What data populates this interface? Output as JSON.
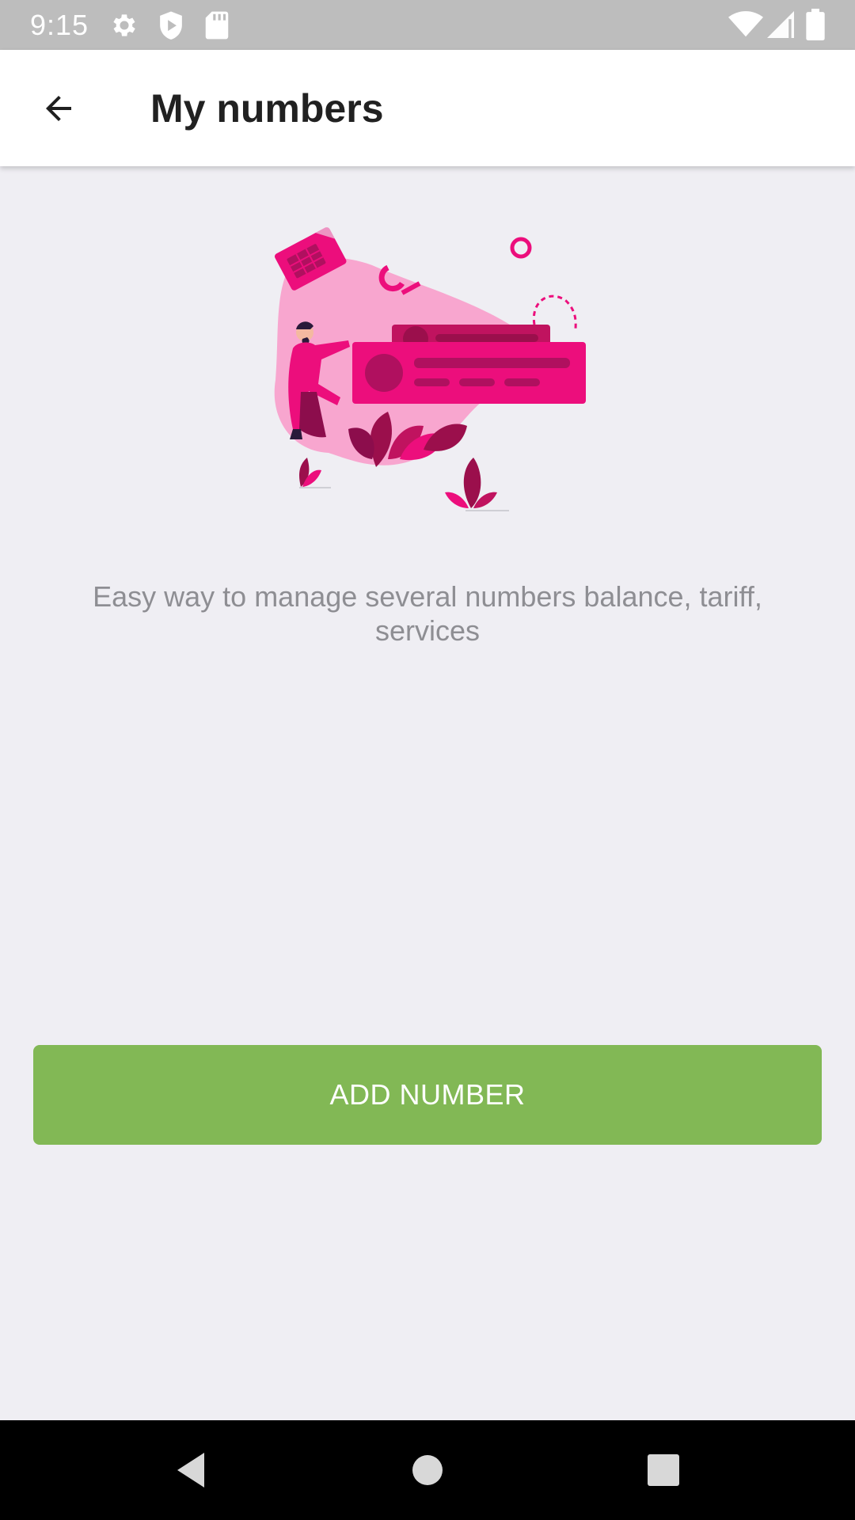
{
  "status_bar": {
    "time": "9:15",
    "left_icons": [
      "settings-icon",
      "shield-play-icon",
      "sd-card-icon"
    ],
    "right_icons": [
      "wifi-icon",
      "cellular-signal-icon",
      "battery-icon"
    ]
  },
  "app_bar": {
    "back_icon": "arrow-left-icon",
    "title": "My numbers"
  },
  "empty_state": {
    "illustration": "man-with-sim-card-illustration",
    "description": "Easy way to manage several numbers balance, tariff, services"
  },
  "actions": {
    "add_number_label": "ADD NUMBER"
  },
  "nav_bar": {
    "buttons": [
      "back-triangle-icon",
      "home-circle-icon",
      "recents-square-icon"
    ]
  },
  "colors": {
    "accent_pink": "#ec0e7c",
    "button_green": "#82b855",
    "background": "#efeef3"
  }
}
